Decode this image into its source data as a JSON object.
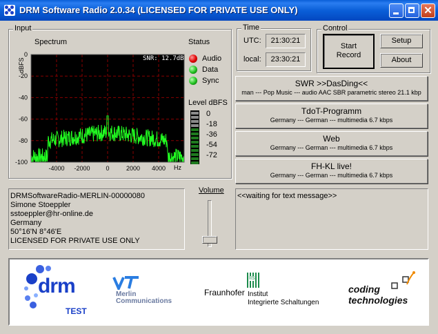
{
  "window": {
    "title": "DRM Software Radio 2.0.34 (LICENSED FOR PRIVATE USE ONLY)"
  },
  "input": {
    "group_label": "Input",
    "spectrum_label": "Spectrum",
    "snr": "SNR: 12.7dB",
    "y_unit": "dBFS",
    "x_unit": "Hz",
    "y_ticks": [
      "0",
      "-20",
      "-40",
      "-60",
      "-80",
      "-100"
    ],
    "x_ticks": [
      "-4000",
      "-2000",
      "0",
      "2000",
      "4000"
    ]
  },
  "status": {
    "label": "Status",
    "items": [
      {
        "label": "Audio",
        "color": "#e00000"
      },
      {
        "label": "Data",
        "color": "#1fbf1f"
      },
      {
        "label": "Sync",
        "color": "#1fbf1f"
      }
    ]
  },
  "level": {
    "label": "Level dBFS",
    "ticks": [
      "0",
      "-18",
      "-36",
      "-54",
      "-72"
    ]
  },
  "time": {
    "group_label": "Time",
    "utc_label": "UTC:",
    "utc": "21:30:21",
    "local_label": "local:",
    "local": "23:30:21"
  },
  "control": {
    "group_label": "Control",
    "start_record_line1": "Start",
    "start_record_line2": "Record",
    "setup": "Setup",
    "about": "About"
  },
  "services": [
    {
      "name": "SWR >>DasDing<<",
      "details": "man --- Pop Music --- audio AAC SBR parametric stereo 21.1 kbp"
    },
    {
      "name": "TdoT-Programm",
      "details": "Germany --- German --- multimedia 6.7 kbps"
    },
    {
      "name": "Web",
      "details": "Germany --- German --- multimedia 6.7 kbps"
    },
    {
      "name": "FH-KL live!",
      "details": "Germany --- German --- multimedia 6.7 kbps"
    }
  ],
  "profile": {
    "lines": [
      "DRMSoftwareRadio-MERLIN-00000080",
      "Simone Stoeppler",
      "sstoeppler@hr-online.de",
      "Germany",
      "50°16'N    8°46'E",
      "LICENSED FOR PRIVATE USE ONLY"
    ]
  },
  "volume": {
    "label": "Volume",
    "level": 0.05
  },
  "text_message": "<<waiting for text message>>",
  "logos": {
    "drm": "drm",
    "drm_test": "TEST",
    "merlin_line1": "Merlin",
    "merlin_line2": "Communications",
    "fraunhofer": "Fraunhofer",
    "iis": "IIS",
    "institut_line1": "Institut",
    "institut_line2": "Integrierte Schaltungen",
    "coding_line1": "coding",
    "coding_line2": "technologies"
  },
  "colors": {
    "spectrum_trace": "#22ff22",
    "grid": "#8a0000",
    "accent_blue": "#1a40c8"
  }
}
